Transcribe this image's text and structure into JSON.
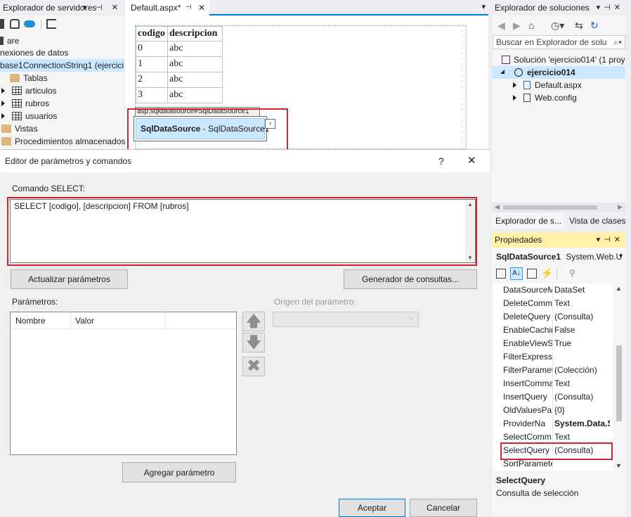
{
  "server_explorer": {
    "title": "Explorador de servidores",
    "items": [
      {
        "label": "are"
      },
      {
        "label": "nexiones de datos"
      },
      {
        "label": "base1ConnectionString1 (ejercici"
      },
      {
        "label": "Tablas"
      },
      {
        "label": "articulos"
      },
      {
        "label": "rubros"
      },
      {
        "label": "usuarios"
      },
      {
        "label": "Vistas"
      },
      {
        "label": "Procedimientos almacenados"
      }
    ]
  },
  "document_tab": {
    "title": "Default.aspx*",
    "grid": {
      "headers": [
        "codigo",
        "descripcion"
      ],
      "rows": [
        [
          "0",
          "abc"
        ],
        [
          "1",
          "abc"
        ],
        [
          "2",
          "abc"
        ],
        [
          "3",
          "abc"
        ]
      ]
    },
    "sds_tag": "asp:sqldatasource#SqlDataSource1",
    "sds_name_bold": "SqlDataSource",
    "sds_name_rest": " - SqlDataSource1"
  },
  "solution_explorer": {
    "title": "Explorador de soluciones",
    "search_placeholder": "Buscar en Explorador de solu",
    "solution_label": "Solución 'ejercicio014' (1 proy",
    "project_label": "ejercicio014",
    "files": [
      "Default.aspx",
      "Web.config"
    ],
    "tabs": [
      "Explorador de s...",
      "Vista de clases"
    ]
  },
  "properties": {
    "title": "Propiedades",
    "object_name": "SqlDataSource1",
    "object_type": "System.Web.U",
    "rows": [
      {
        "name": "DataSourceM",
        "value": "DataSet",
        "bold": false
      },
      {
        "name": "DeleteComm",
        "value": "Text",
        "bold": false
      },
      {
        "name": "DeleteQuery",
        "value": "(Consulta)",
        "bold": false
      },
      {
        "name": "EnableCachin",
        "value": "False",
        "bold": false
      },
      {
        "name": "EnableViewSt",
        "value": "True",
        "bold": false
      },
      {
        "name": "FilterExpressi",
        "value": "",
        "bold": false
      },
      {
        "name": "FilterParamet",
        "value": "(Colección)",
        "bold": false
      },
      {
        "name": "InsertComma",
        "value": "Text",
        "bold": false
      },
      {
        "name": "InsertQuery",
        "value": "(Consulta)",
        "bold": false
      },
      {
        "name": "OldValuesPar",
        "value": "{0}",
        "bold": false
      },
      {
        "name": "ProviderNa",
        "value": "System.Data.S",
        "bold": true
      },
      {
        "name": "SelectComm",
        "value": "Text",
        "bold": false
      },
      {
        "name": "SelectQuery",
        "value": "(Consulta)",
        "bold": false
      },
      {
        "name": "SortParamete",
        "value": "",
        "bold": false
      }
    ],
    "desc_title": "SelectQuery",
    "desc_text": "Consulta de selección"
  },
  "dialog": {
    "title": "Editor de parámetros y comandos",
    "help": "?",
    "close": "✕",
    "command_label": "Comando SELECT:",
    "command_text": "SELECT [codigo], [descripcion] FROM [rubros]",
    "refresh_button": "Actualizar parámetros",
    "query_builder_button": "Generador de consultas...",
    "params_label": "Parámetros:",
    "col_name": "Nombre",
    "col_value": "Valor",
    "source_label": "Origen del parámetro:",
    "add_param_button": "Agregar parámetro",
    "ok_button": "Aceptar",
    "cancel_button": "Cancelar"
  },
  "colors": {
    "accent": "#007acc",
    "highlight_red": "#d0252d",
    "selection_blue": "#cce8ff"
  }
}
